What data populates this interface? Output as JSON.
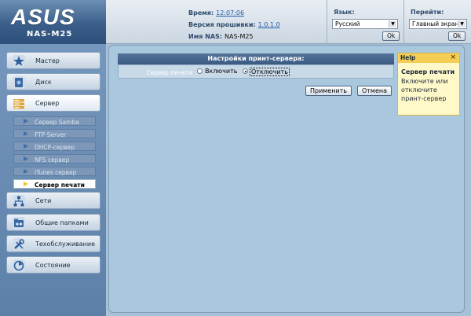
{
  "brand": {
    "logo": "ASUS",
    "model": "NAS-M25"
  },
  "info": {
    "time_label": "Время:",
    "time_value": "12:07:06",
    "firmware_label": "Версия прошивки:",
    "firmware_value": "1.0.1.0",
    "nas_label": "Имя NAS:",
    "nas_value": "NAS-M25"
  },
  "language": {
    "label": "Язык:",
    "selected": "Русский",
    "ok": "Ok"
  },
  "goto": {
    "label": "Перейти:",
    "selected": "Главный экран",
    "ok": "Ok"
  },
  "nav": {
    "items": [
      {
        "label": "Мастер",
        "icon": "wand-icon"
      },
      {
        "label": "Диск",
        "icon": "disk-icon"
      },
      {
        "label": "Сервер",
        "icon": "server-icon"
      },
      {
        "label": "Сети",
        "icon": "network-icon"
      },
      {
        "label": "Общие папками",
        "icon": "shared-folders-icon"
      },
      {
        "label": "Техобслуживание",
        "icon": "tools-icon"
      },
      {
        "label": "Состояние",
        "icon": "status-icon"
      }
    ],
    "server_sub": [
      "Сервер Samba",
      "FTP Server",
      "DHCP-сервер",
      "NFS сервер",
      "ITunes сервер",
      "Сервер печати"
    ]
  },
  "panel": {
    "title": "Настройки принт-сервера:",
    "field_label": "Сервер печати",
    "option_on": "Включить",
    "option_off": "Отключить",
    "apply": "Применить",
    "cancel": "Отмена"
  },
  "help": {
    "header": "Help",
    "close": "×",
    "title": "Сервер печати",
    "text": "Включите или отключите принт-сервер"
  },
  "colors": {
    "header_blue": "#3b5f8a",
    "help_yellow": "#f3cd54",
    "panel_blue": "#a9c7dd"
  }
}
